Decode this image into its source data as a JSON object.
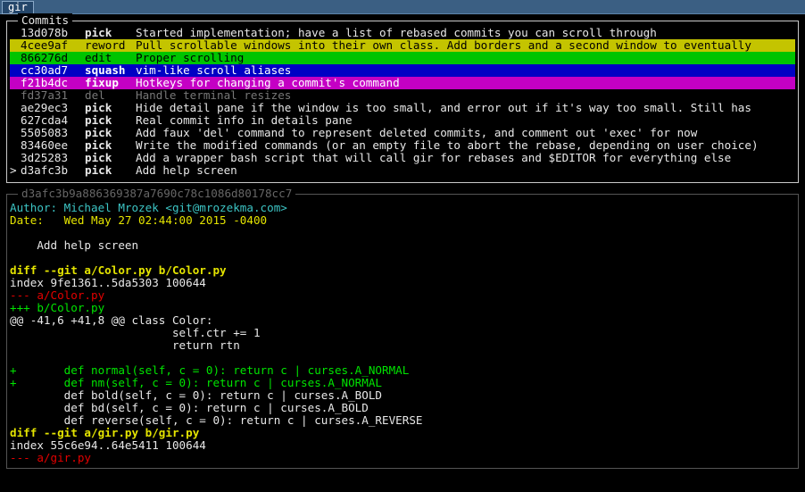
{
  "window": {
    "tab_title": "gir"
  },
  "commits": {
    "title": "Commits",
    "rows": [
      {
        "marker": "",
        "hash": "13d078b",
        "action": "pick",
        "message": "Started implementation; have a list of rebased commits you can scroll through",
        "style": ""
      },
      {
        "marker": "",
        "hash": "4cee9af",
        "action": "reword",
        "message": "Pull scrollable windows into their own class. Add borders and a second window to eventually",
        "style": "sel-yellow"
      },
      {
        "marker": "",
        "hash": "866276d",
        "action": "edit",
        "message": "Proper scrolling",
        "style": "sel-green"
      },
      {
        "marker": "",
        "hash": "cc30ad7",
        "action": "squash",
        "message": "vim-like scroll aliases",
        "style": "sel-blue"
      },
      {
        "marker": "",
        "hash": "f21b4dc",
        "action": "fixup",
        "message": "Hotkeys for changing a commit's command",
        "style": "sel-magenta"
      },
      {
        "marker": "",
        "hash": "fd37a31",
        "action": "del",
        "message": "Handle terminal resizes",
        "style": "dim"
      },
      {
        "marker": "",
        "hash": "ae29ec3",
        "action": "pick",
        "message": "Hide detail pane if the window is too small, and error out if it's way too small. Still has",
        "style": ""
      },
      {
        "marker": "",
        "hash": "627cda4",
        "action": "pick",
        "message": "Real commit info in details pane",
        "style": ""
      },
      {
        "marker": "",
        "hash": "5505083",
        "action": "pick",
        "message": "Add faux 'del' command to represent deleted commits, and comment out 'exec' for now",
        "style": ""
      },
      {
        "marker": "",
        "hash": "83460ee",
        "action": "pick",
        "message": "Write the modified commands (or an empty file to abort the rebase, depending on user choice)",
        "style": ""
      },
      {
        "marker": "",
        "hash": "3d25283",
        "action": "pick",
        "message": "Add a wrapper bash script that will call gir for rebases and $EDITOR for everything else",
        "style": ""
      },
      {
        "marker": ">",
        "hash": "d3afc3b",
        "action": "pick",
        "message": "Add help screen",
        "style": ""
      }
    ]
  },
  "detail": {
    "title": "d3afc3b9a886369387a7690c78c1086d80178cc7",
    "lines": [
      {
        "text": "Author: Michael Mrozek <git@mrozekma.com>",
        "cls": "cyan"
      },
      {
        "text": "Date:   Wed May 27 02:44:00 2015 -0400",
        "cls": "yellow"
      },
      {
        "text": "",
        "cls": ""
      },
      {
        "text": "    Add help screen",
        "cls": ""
      },
      {
        "text": "",
        "cls": ""
      },
      {
        "text": "diff --git a/Color.py b/Color.py",
        "cls": "yellow bold"
      },
      {
        "text": "index 9fe1361..5da5303 100644",
        "cls": ""
      },
      {
        "text": "--- a/Color.py",
        "cls": "red"
      },
      {
        "text": "+++ b/Color.py",
        "cls": "green"
      },
      {
        "text": "@@ -41,6 +41,8 @@ class Color:",
        "cls": ""
      },
      {
        "text": "                        self.ctr += 1",
        "cls": ""
      },
      {
        "text": "                        return rtn",
        "cls": ""
      },
      {
        "text": "",
        "cls": ""
      },
      {
        "text": "+       def normal(self, c = 0): return c | curses.A_NORMAL",
        "cls": "green"
      },
      {
        "text": "+       def nm(self, c = 0): return c | curses.A_NORMAL",
        "cls": "green"
      },
      {
        "text": "        def bold(self, c = 0): return c | curses.A_BOLD",
        "cls": ""
      },
      {
        "text": "        def bd(self, c = 0): return c | curses.A_BOLD",
        "cls": ""
      },
      {
        "text": "        def reverse(self, c = 0): return c | curses.A_REVERSE",
        "cls": ""
      },
      {
        "text": "diff --git a/gir.py b/gir.py",
        "cls": "yellow bold"
      },
      {
        "text": "index 55c6e94..64e5411 100644",
        "cls": ""
      },
      {
        "text": "--- a/gir.py",
        "cls": "red"
      }
    ]
  }
}
